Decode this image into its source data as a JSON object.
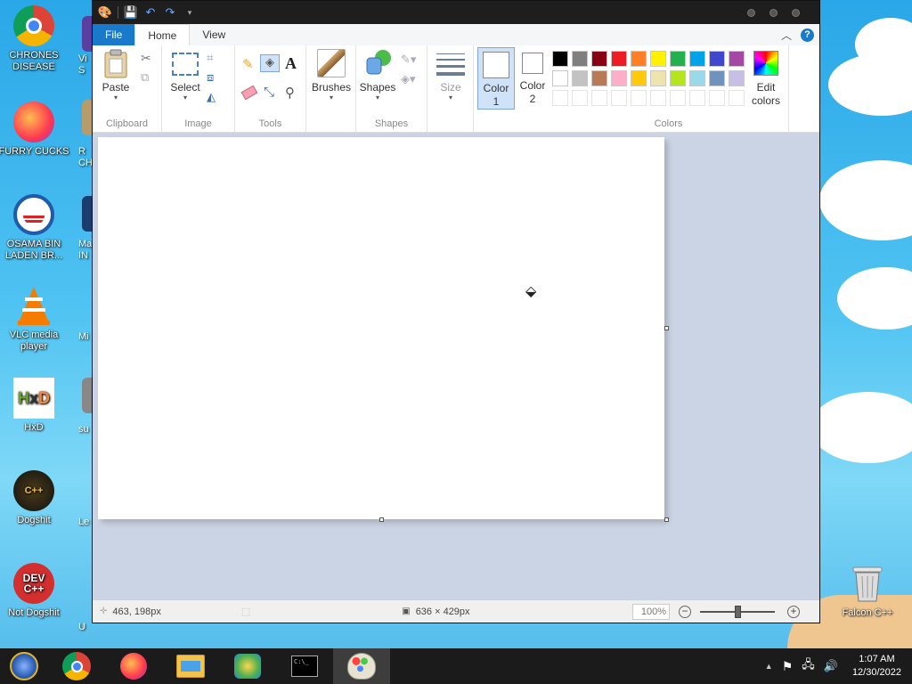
{
  "desktop": {
    "icons": [
      {
        "label": "CHRONES DISEASE"
      },
      {
        "label": "FURRY CUCKS"
      },
      {
        "label": "OSAMA BIN LADEN BR..."
      },
      {
        "label": "VLC media player"
      },
      {
        "label": "HxD"
      },
      {
        "label": "Dogshit"
      },
      {
        "label": "Not Dogshit"
      }
    ],
    "partial_labels": [
      "Vi",
      "S",
      "R",
      "CH",
      "Ma",
      "IN",
      "Mi",
      "su",
      "Le",
      "U"
    ],
    "recycle_bin": {
      "label": "Falcon C++"
    }
  },
  "window": {
    "tabs": {
      "file": "File",
      "home": "Home",
      "view": "View"
    },
    "ribbon": {
      "clipboard": {
        "paste": "Paste",
        "group": "Clipboard"
      },
      "image": {
        "select": "Select",
        "group": "Image"
      },
      "tools": {
        "group": "Tools",
        "text_glyph": "A"
      },
      "brushes": {
        "label": "Brushes"
      },
      "shapes": {
        "label": "Shapes",
        "group": "Shapes"
      },
      "size": {
        "label": "Size"
      },
      "color1": {
        "label": "Color 1"
      },
      "color2": {
        "label": "Color 2"
      },
      "colors": {
        "group": "Colors",
        "edit": "Edit colors"
      },
      "palette_row1": [
        "#000000",
        "#7f7f7f",
        "#880015",
        "#ed1c24",
        "#ff7f27",
        "#fff200",
        "#22b14c",
        "#00a2e8",
        "#3f48cc",
        "#a349a4"
      ],
      "palette_row2": [
        "#ffffff",
        "#c3c3c3",
        "#b97a57",
        "#ffaec9",
        "#ffc90e",
        "#efe4b0",
        "#b5e61d",
        "#99d9ea",
        "#7092be",
        "#c8bfe7"
      ]
    },
    "statusbar": {
      "cursor_pos": "463, 198px",
      "canvas_size": "636 × 429px",
      "zoom": "100%"
    }
  },
  "taskbar": {
    "clock_time": "1:07 AM",
    "clock_date": "12/30/2022"
  },
  "colors": {
    "file_tab": "#1979ca",
    "canvas_bg": "#cbd4e4",
    "taskbar": "#1b1b1b"
  }
}
